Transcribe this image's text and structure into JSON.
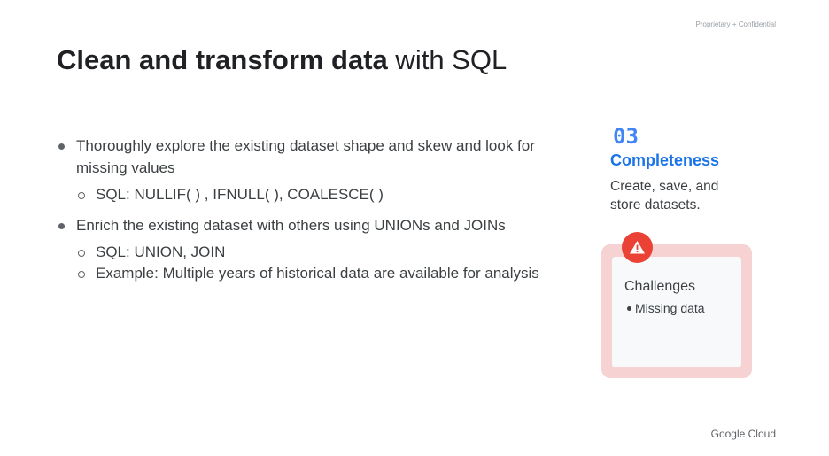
{
  "header": {
    "confidential": "Proprietary + Confidential",
    "title_bold": "Clean and transform data",
    "title_rest": " with SQL"
  },
  "bullets": [
    {
      "text": "Thoroughly explore the existing dataset shape and skew and look for missing values",
      "subs": [
        "SQL: NULLIF( ) , IFNULL( ),  COALESCE( )"
      ]
    },
    {
      "text": "Enrich the existing dataset with others using UNIONs and JOINs",
      "subs": [
        "SQL: UNION, JOIN",
        "Example: Multiple years of historical data are available for analysis"
      ]
    }
  ],
  "step": {
    "number": "03",
    "title": "Completeness",
    "description": "Create, save, and store datasets."
  },
  "challenges": {
    "title": "Challenges",
    "items": [
      "Missing data"
    ]
  },
  "footer": {
    "logo": "Google Cloud"
  },
  "colors": {
    "accent_blue": "#1a73e8",
    "warning_red": "#ea4335",
    "challenge_bg": "#f6d2d2"
  },
  "icons": {
    "warning": "warning-icon"
  }
}
